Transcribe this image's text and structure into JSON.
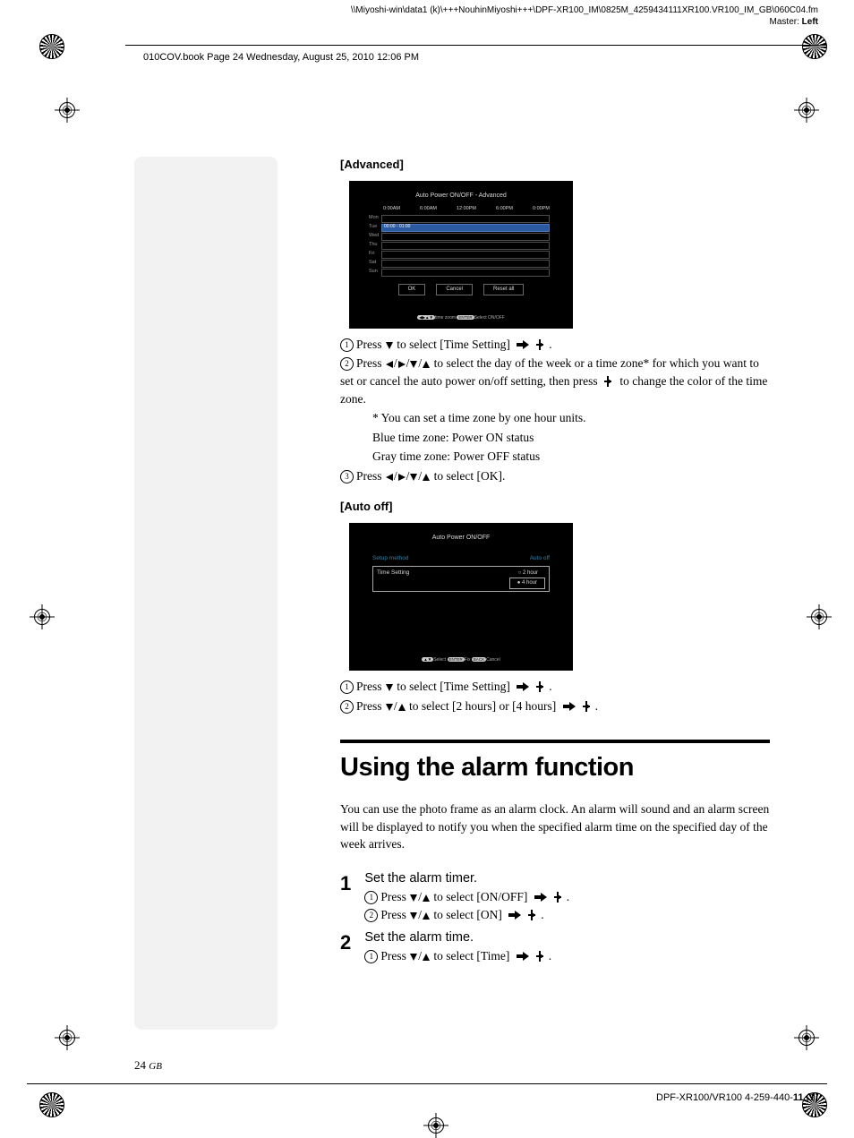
{
  "header": {
    "path": "\\\\Miyoshi-win\\data1 (k)\\+++NouhinMiyoshi+++\\DPF-XR100_IM\\0825M_4259434111XR100.VR100_IM_GB\\060C04.fm",
    "master": "Master:",
    "master_val": "Left",
    "book_line": "010COV.book  Page 24  Wednesday, August 25, 2010  12:06 PM"
  },
  "advanced": {
    "label": "[Advanced]",
    "screenshot": {
      "title": "Auto Power ON/OFF - Advanced",
      "times": [
        "0:00AM",
        "6:00AM",
        "12:00PM",
        "6:00PM",
        "0:00PM"
      ],
      "days": [
        "Mon",
        "Tue",
        "Wed",
        "Thu",
        "Fri",
        "Sat",
        "Sun"
      ],
      "highlight_time": "00:00 - 01:00",
      "buttons": [
        "OK",
        "Cancel",
        "Reset all"
      ],
      "footer_a": "time zoom",
      "footer_b": "ENTER",
      "footer_c": "Select ON/OFF"
    },
    "step1": "Press ",
    "step1b": " to select [Time Setting] ",
    "step2a": "Press ",
    "step2b": " to select the day of the week or a time zone* for which you want to set or cancel the auto power on/off setting, then press ",
    "step2c": " to change the color of the time zone.",
    "note1": "* You can set a time zone by one hour units.",
    "note2": "Blue time zone: Power ON status",
    "note3": "Gray time zone: Power OFF status",
    "step3a": "Press ",
    "step3b": " to select [OK]."
  },
  "autooff": {
    "label": "[Auto off]",
    "screenshot": {
      "title": "Auto Power ON/OFF",
      "row1a": "Setup method",
      "row1b": "Auto off",
      "row2": "Time Setting",
      "opt1": "2 hour",
      "opt2": "4 hour",
      "footer_a": "Select",
      "footer_b": "ENTER",
      "footer_c": "Fix",
      "footer_d": "BACK",
      "footer_e": "Cancel"
    },
    "step1": "Press ",
    "step1b": " to select [Time Setting] ",
    "step2a": "Press ",
    "step2b": " to select [2 hours] or [4 hours] "
  },
  "heading": "Using the alarm function",
  "intro": "You can use the photo frame as an alarm clock. An alarm will sound and an alarm screen will be displayed to notify you when the specified alarm time on the specified day of the week arrives.",
  "steps": {
    "s1_title": "Set the alarm timer.",
    "s1_1a": "Press ",
    "s1_1b": " to select [ON/OFF] ",
    "s1_2a": "Press ",
    "s1_2b": " to select [ON] ",
    "s2_title": "Set the alarm time.",
    "s2_1a": "Press ",
    "s2_1b": " to select [Time] "
  },
  "page_number": "24",
  "page_region": "GB",
  "footer": "DPF-XR100/VR100 4-259-440-",
  "footer_bold": "11",
  "footer_tail": " (1)"
}
